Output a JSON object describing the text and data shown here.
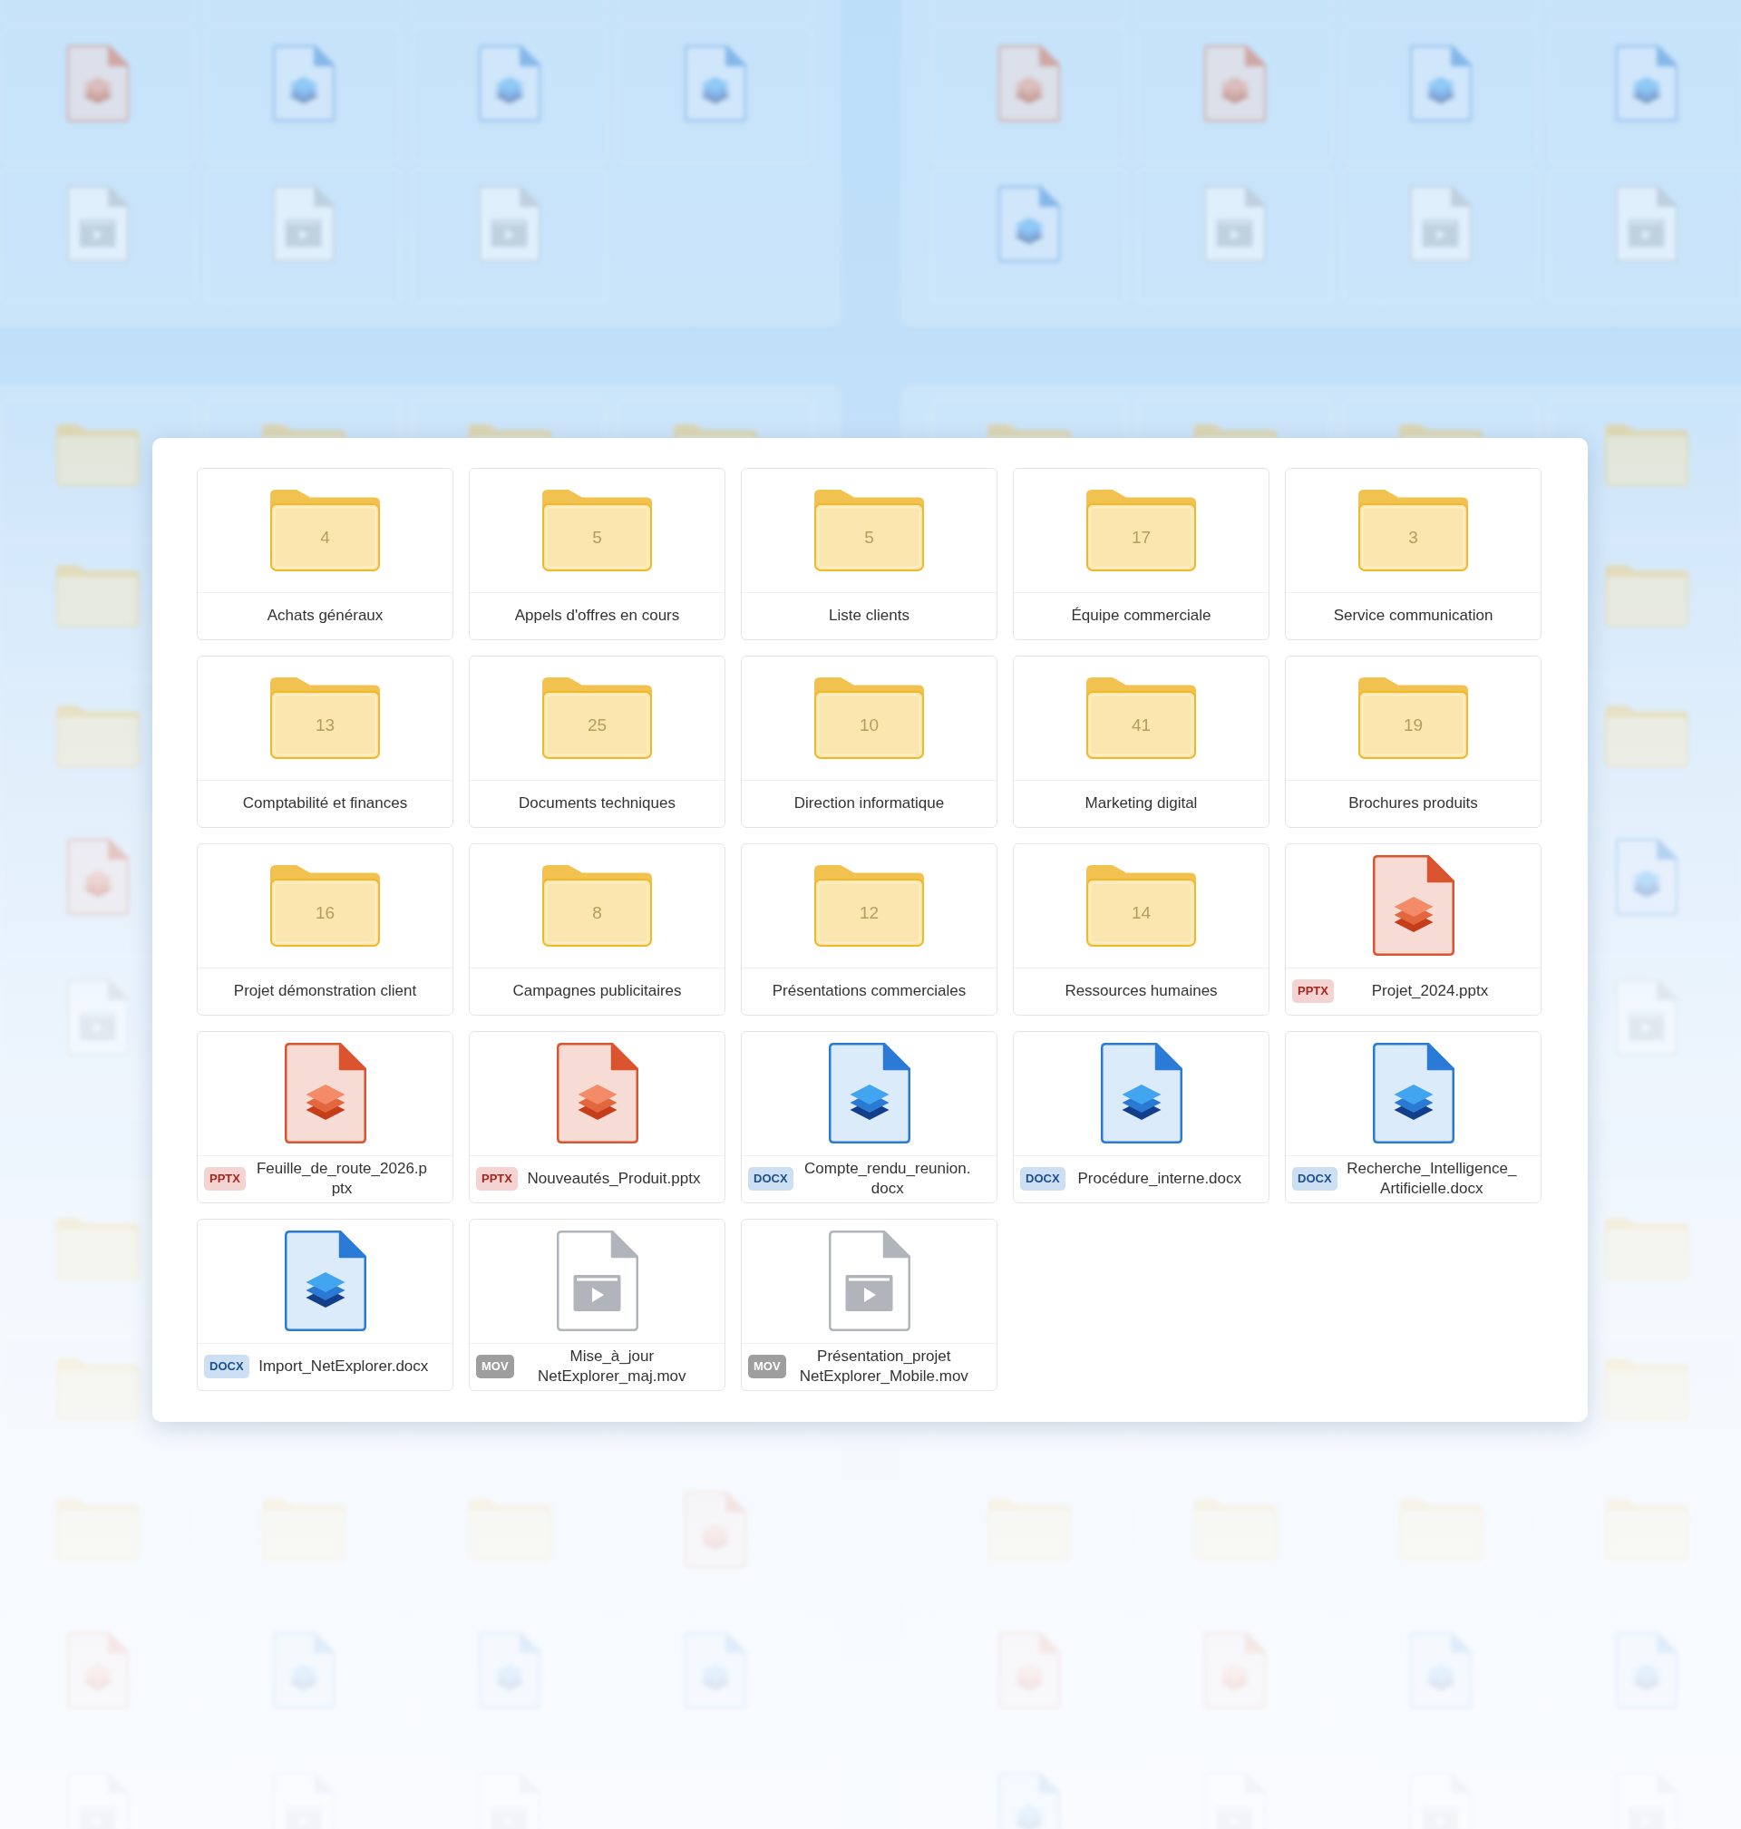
{
  "file_grid": {
    "items": [
      {
        "kind": "folder",
        "name": "Achats généraux",
        "count": "4"
      },
      {
        "kind": "folder",
        "name": "Appels d'offres en cours",
        "count": "5"
      },
      {
        "kind": "folder",
        "name": "Liste clients",
        "count": "5"
      },
      {
        "kind": "folder",
        "name": "Équipe commerciale",
        "count": "17"
      },
      {
        "kind": "folder",
        "name": "Service communication",
        "count": "3"
      },
      {
        "kind": "folder",
        "name": "Comptabilité et finances",
        "count": "13"
      },
      {
        "kind": "folder",
        "name": "Documents techniques",
        "count": "25"
      },
      {
        "kind": "folder",
        "name": "Direction informatique",
        "count": "10"
      },
      {
        "kind": "folder",
        "name": "Marketing digital",
        "count": "41"
      },
      {
        "kind": "folder",
        "name": "Brochures produits",
        "count": "19"
      },
      {
        "kind": "folder",
        "name": "Projet démonstration client",
        "count": "16"
      },
      {
        "kind": "folder",
        "name": "Campagnes publicitaires",
        "count": "8"
      },
      {
        "kind": "folder",
        "name": "Présentations commerciales",
        "count": "12"
      },
      {
        "kind": "folder",
        "name": "Ressources humaines",
        "count": "14"
      },
      {
        "kind": "pptx",
        "badge": "PPTX",
        "name": "Projet_2024.pptx"
      },
      {
        "kind": "pptx",
        "badge": "PPTX",
        "name": "Feuille_de_route_2026.pptx"
      },
      {
        "kind": "pptx",
        "badge": "PPTX",
        "name": "Nouveautés_Produit.pptx"
      },
      {
        "kind": "docx",
        "badge": "DOCX",
        "name": "Compte_rendu_reunion.docx"
      },
      {
        "kind": "docx",
        "badge": "DOCX",
        "name": "Procédure_interne.docx"
      },
      {
        "kind": "docx",
        "badge": "DOCX",
        "name": "Recherche_Intelligence_Artificielle.docx"
      },
      {
        "kind": "docx",
        "badge": "DOCX",
        "name": "Import_NetExplorer.docx"
      },
      {
        "kind": "mov",
        "badge": "MOV",
        "name": "Mise_à_jour NetExplorer_maj.mov"
      },
      {
        "kind": "mov",
        "badge": "MOV",
        "name": "Présentation_projet NetExplorer_Mobile.mov"
      }
    ]
  }
}
